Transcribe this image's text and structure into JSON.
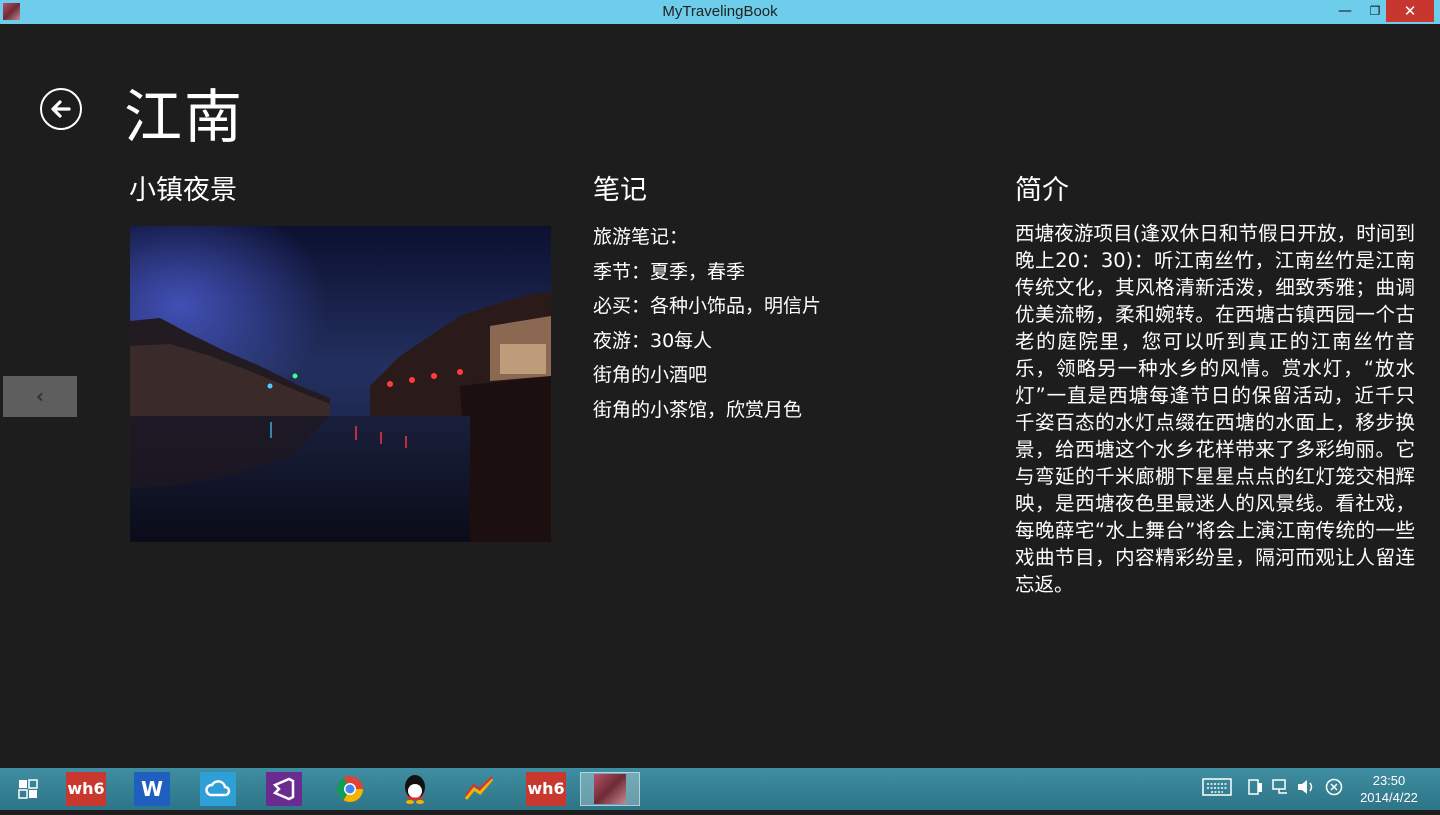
{
  "window": {
    "title": "MyTravelingBook",
    "minimize_glyph": "—",
    "maximize_glyph": "❐",
    "close_glyph": "✕"
  },
  "page": {
    "title": "江南",
    "back_icon": "back-arrow-circle-icon"
  },
  "sections": {
    "photo_heading": "小镇夜景",
    "notes_heading": "笔记",
    "intro_heading": "简介"
  },
  "notes": [
    "旅游笔记：",
    "季节：夏季，春季",
    "必买：各种小饰品，明信片",
    "夜游：30每人",
    "街角的小酒吧",
    "街角的小茶馆，欣赏月色"
  ],
  "intro": "西塘夜游项目(逢双休日和节假日开放，时间到晚上20：30)：听江南丝竹，江南丝竹是江南传统文化，其风格清新活泼，细致秀雅；曲调优美流畅，柔和婉转。在西塘古镇西园一个古老的庭院里，您可以听到真正的江南丝竹音乐，领略另一种水乡的风情。赏水灯，“放水灯”一直是西塘每逢节日的保留活动，近千只千姿百态的水灯点缀在西塘的水面上，移步换景，给西塘这个水乡花样带来了多彩绚丽。它与弯延的千米廊棚下星星点点的红灯笼交相辉映，是西塘夜色里最迷人的风景线。看社戏，每晚薛宅“水上舞台”将会上演江南传统的一些戏曲节目，内容精彩纷呈，隔河而观让人留连忘返。",
  "side_nav": {
    "glyph": "‹"
  },
  "taskbar": {
    "apps": [
      {
        "name": "task-view-icon",
        "label": ""
      },
      {
        "name": "wh6-app-icon",
        "label": "wh6"
      },
      {
        "name": "word-app-icon",
        "label": "W"
      },
      {
        "name": "cloud-app-icon",
        "label": ""
      },
      {
        "name": "visual-studio-icon",
        "label": ""
      },
      {
        "name": "chrome-icon",
        "label": ""
      },
      {
        "name": "qq-icon",
        "label": ""
      },
      {
        "name": "chart-app-icon",
        "label": ""
      },
      {
        "name": "wh6-app-icon-2",
        "label": "wh6"
      },
      {
        "name": "mytravelingbook-app-icon",
        "label": ""
      }
    ],
    "tray_icons": [
      "keyboard-icon",
      "device-icon",
      "network-icon",
      "volume-icon",
      "close-circle-icon"
    ],
    "clock_time": "23:50",
    "clock_date": "2014/4/22"
  },
  "colors": {
    "titlebar": "#6dcdea",
    "background": "#1d1d1d",
    "taskbar": "#3a8598",
    "close_button": "#c7372f"
  }
}
